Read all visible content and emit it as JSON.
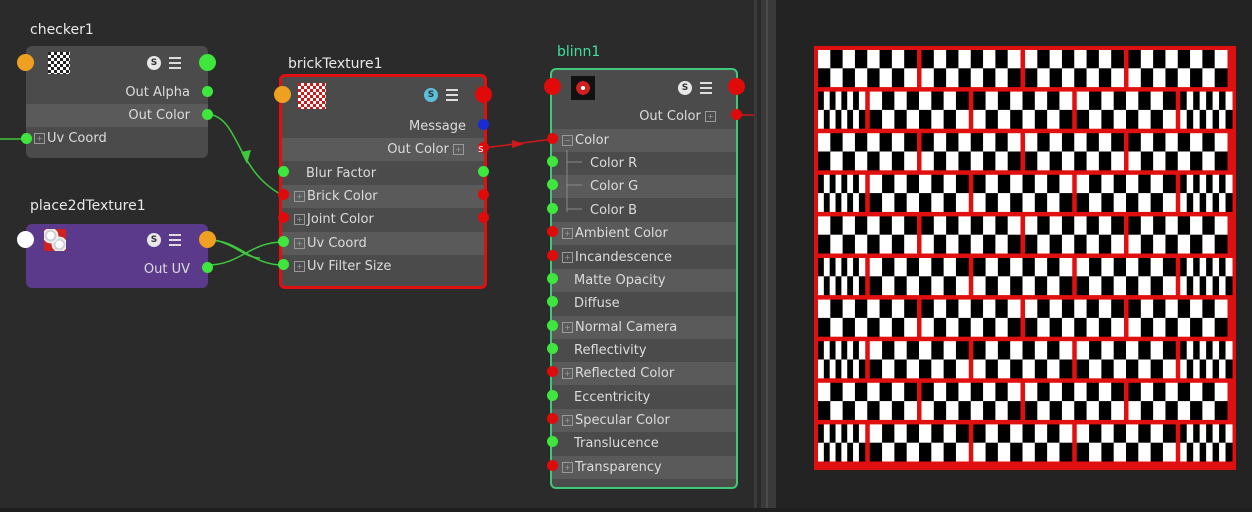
{
  "graph": {
    "checker": {
      "title": "checker1",
      "rows": [
        "Out Alpha",
        "Out Color",
        "Uv Coord"
      ]
    },
    "brick": {
      "title": "brickTexture1",
      "rows": [
        "Message",
        "Out Color",
        "Blur Factor",
        "Brick Color",
        "Joint Color",
        "Uv Coord",
        "Uv Filter Size"
      ]
    },
    "place2d": {
      "title": "place2dTexture1",
      "rows": [
        "Out UV"
      ]
    },
    "blinn": {
      "title": "blinn1",
      "rows": [
        "Out Color",
        "Color",
        "Color R",
        "Color G",
        "Color B",
        "Ambient Color",
        "Incandescence",
        "Matte Opacity",
        "Diffuse",
        "Normal Camera",
        "Reflectivity",
        "Reflected Color",
        "Eccentricity",
        "Specular Color",
        "Translucence",
        "Transparency"
      ]
    },
    "swatch_s": "S",
    "out_color_marker": "s"
  },
  "colors": {
    "graph_bg": "#2b2b2b",
    "node_grey": "#4b4b4b",
    "node_purple": "#5b3a8c",
    "brick_border": "#e01010",
    "blinn_border": "#40c878",
    "port_green": "#3ee63e",
    "port_red": "#e00a0a",
    "port_orange": "#f0a020",
    "port_blue": "#1a2bd6",
    "edge_green": "#3ec83e",
    "edge_red": "#d01818"
  },
  "icons": [
    "checker-swatch-icon",
    "brick-swatch-icon",
    "place2d-swatch-icon",
    "blinn-swatch-icon",
    "swatch-toggle-icon",
    "attribute-menu-icon"
  ]
}
